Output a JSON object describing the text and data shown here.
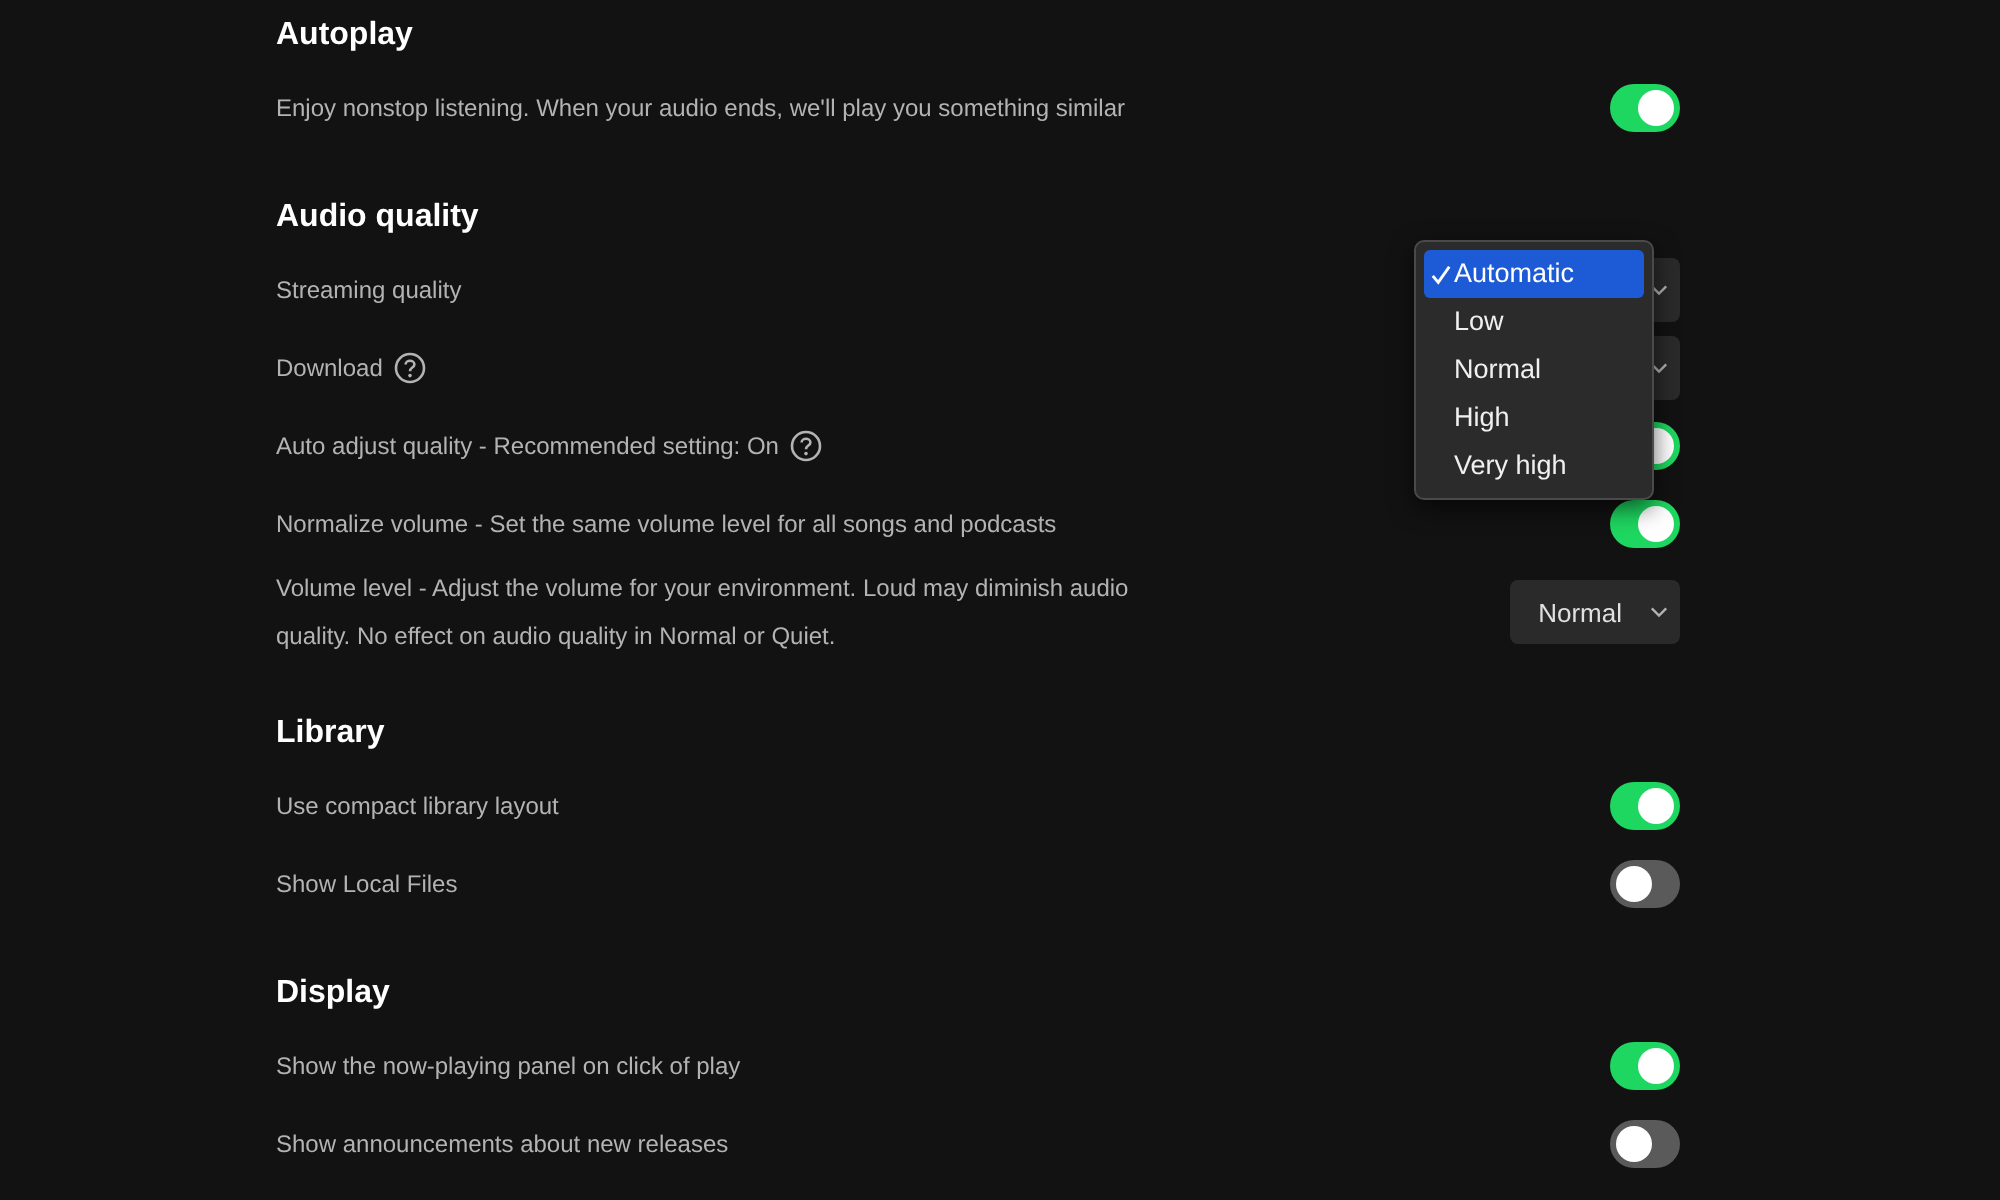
{
  "sections": [
    {
      "title": "Autoplay",
      "rows": [
        {
          "kind": "toggle",
          "label": "Enjoy nonstop listening. When your audio ends, we'll play you something similar",
          "on": true
        }
      ]
    },
    {
      "title": "Audio quality",
      "rows": [
        {
          "kind": "select",
          "label": "Streaming quality",
          "menu": {
            "options": [
              {
                "label": "Automatic",
                "selected": true
              },
              {
                "label": "Low",
                "selected": false
              },
              {
                "label": "Normal",
                "selected": false
              },
              {
                "label": "High",
                "selected": false
              },
              {
                "label": "Very high",
                "selected": false
              }
            ]
          }
        },
        {
          "kind": "select",
          "label": "Download",
          "help": true
        },
        {
          "kind": "toggle",
          "label": "Auto adjust quality - Recommended setting: On",
          "help": true,
          "on": true
        },
        {
          "kind": "toggle",
          "label": "Normalize volume - Set the same volume level for all songs and podcasts",
          "on": true
        },
        {
          "kind": "select",
          "label": "Volume level - Adjust the volume for your environment. Loud may diminish audio quality. No effect on audio quality in Normal or Quiet.",
          "value": "Normal"
        }
      ]
    },
    {
      "title": "Library",
      "rows": [
        {
          "kind": "toggle",
          "label": "Use compact library layout",
          "on": true
        },
        {
          "kind": "toggle",
          "label": "Show Local Files",
          "on": false
        }
      ]
    },
    {
      "title": "Display",
      "rows": [
        {
          "kind": "toggle",
          "label": "Show the now-playing panel on click of play",
          "on": true
        },
        {
          "kind": "toggle",
          "label": "Show announcements about new releases",
          "on": false
        }
      ]
    }
  ]
}
